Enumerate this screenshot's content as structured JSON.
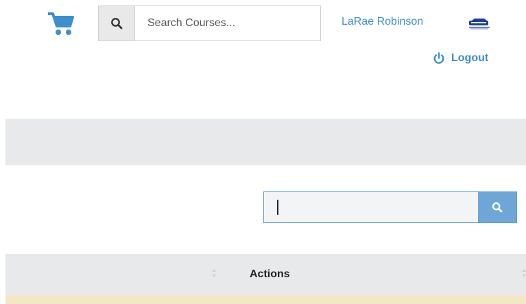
{
  "header": {
    "search": {
      "placeholder": "Search Courses..."
    },
    "user": {
      "name": "LaRae Robinson"
    },
    "logout_label": "Logout"
  },
  "table": {
    "search": {
      "value": ""
    },
    "columns": [
      "Actions"
    ]
  },
  "icons": {
    "cart": "shopping-cart-icon",
    "search": "search-icon",
    "power": "power-icon",
    "sort": "sort-icon"
  },
  "colors": {
    "accent": "#3d8ec9",
    "search_button": "#6fa6d6",
    "band": "#e8e9eb",
    "row_highlight": "#f4e7c6"
  }
}
